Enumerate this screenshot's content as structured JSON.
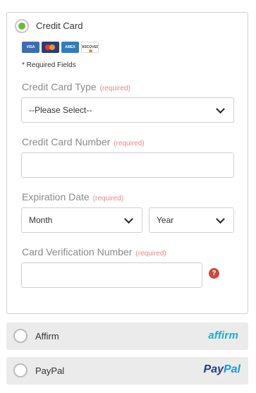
{
  "credit_card": {
    "title": "Credit Card",
    "card_brands": [
      "VISA",
      "MasterCard",
      "AMEX",
      "DISCOVER"
    ],
    "required_note": "* Required Fields",
    "type": {
      "label": "Credit Card Type",
      "required": "(required)",
      "value": "--Please Select--"
    },
    "number": {
      "label": "Credit Card Number",
      "required": "(required)",
      "value": ""
    },
    "expiration": {
      "label": "Expiration Date",
      "required": "(required)",
      "month": "Month",
      "year": "Year"
    },
    "cvv": {
      "label": "Card Verification Number",
      "required": "(required)",
      "value": "",
      "help": "?"
    }
  },
  "affirm": {
    "label": "Affirm",
    "logo": "affirm"
  },
  "paypal": {
    "label": "PayPal",
    "logo_part1": "Pay",
    "logo_part2": "Pal"
  },
  "colors": {
    "selected_radio": "#6cbb3c",
    "required_text": "#e7878b",
    "help_icon": "#c94a3b"
  }
}
